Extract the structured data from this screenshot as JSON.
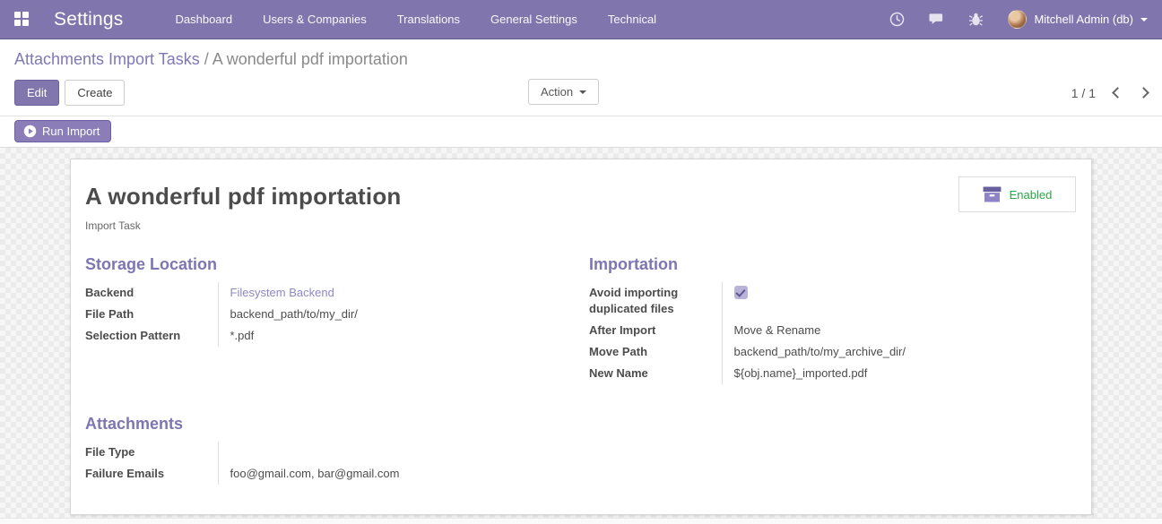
{
  "navbar": {
    "app_title": "Settings",
    "menu_items": [
      "Dashboard",
      "Users & Companies",
      "Translations",
      "General Settings",
      "Technical"
    ],
    "icons": [
      "activities-clock-icon",
      "messages-icon",
      "debug-bug-icon"
    ],
    "user_name": "Mitchell Admin (db)"
  },
  "control_panel": {
    "breadcrumb": {
      "parent": "Attachments Import Tasks",
      "separator": " / ",
      "current": "A wonderful pdf importation"
    },
    "buttons": {
      "edit": "Edit",
      "create": "Create",
      "action": "Action"
    },
    "pager": {
      "value": "1 / 1"
    }
  },
  "statusbar": {
    "run_import_label": "Run Import"
  },
  "sheet": {
    "title": "A wonderful pdf importation",
    "subtitle": "Import Task",
    "enabled_button": {
      "label": "Enabled",
      "icon": "archive-box-icon"
    },
    "groups": [
      {
        "title": "Storage Location",
        "fields": [
          {
            "label": "Backend",
            "value": "Filesystem Backend",
            "type": "link"
          },
          {
            "label": "File Path",
            "value": "backend_path/to/my_dir/",
            "type": "text"
          },
          {
            "label": "Selection Pattern",
            "value": "*.pdf",
            "type": "text"
          }
        ]
      },
      {
        "title": "Importation",
        "fields": [
          {
            "label": "Avoid importing duplicated files",
            "type": "checkbox",
            "checked": true
          },
          {
            "label": "After Import",
            "value": "Move & Rename",
            "type": "text"
          },
          {
            "label": "Move Path",
            "value": "backend_path/to/my_archive_dir/",
            "type": "text"
          },
          {
            "label": "New Name",
            "value": "${obj.name}_imported.pdf",
            "type": "text"
          }
        ]
      },
      {
        "title": "Attachments",
        "fields": [
          {
            "label": "File Type",
            "value": "",
            "type": "text"
          },
          {
            "label": "Failure Emails",
            "value": "foo@gmail.com, bar@gmail.com",
            "type": "text"
          }
        ]
      }
    ]
  },
  "colors": {
    "navbar_bg": "#8076ad",
    "primary_button": "#8176ae",
    "heading_purple": "#7c76b2",
    "breadcrumb_link": "#8078b5",
    "field_link": "#8e88c4",
    "enabled_green": "#28a745",
    "text_dark": "#4c4c4c"
  }
}
